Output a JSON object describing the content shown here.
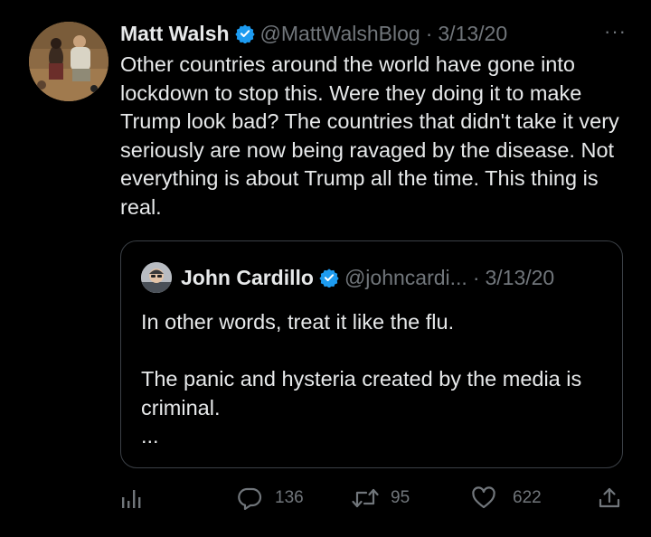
{
  "tweet": {
    "author_name": "Matt Walsh",
    "handle": "@MattWalshBlog",
    "separator": "·",
    "date": "3/13/20",
    "more_label": "···",
    "text": "Other countries around the world have gone into lockdown to stop this. Were they doing it to make Trump look bad? The countries that didn't take it very seriously are now being ravaged by the disease. Not everything is about Trump all the time. This thing is real."
  },
  "quoted": {
    "author_name": "John Cardillo",
    "handle": "@johncardi...",
    "separator": "·",
    "date": "3/13/20",
    "text": "In other words, treat it like the flu.\n\nThe panic and hysteria created by the media is criminal.\n..."
  },
  "actions": {
    "replies": "136",
    "retweets": "95",
    "likes": "622"
  },
  "colors": {
    "background": "#000000",
    "text": "#e7e9ea",
    "secondary": "#71767b",
    "verified": "#1d9bf0",
    "border": "#3b4046"
  },
  "icons": [
    "analytics-icon",
    "reply-icon",
    "retweet-icon",
    "like-icon",
    "share-icon",
    "verified-badge-icon",
    "more-icon"
  ]
}
